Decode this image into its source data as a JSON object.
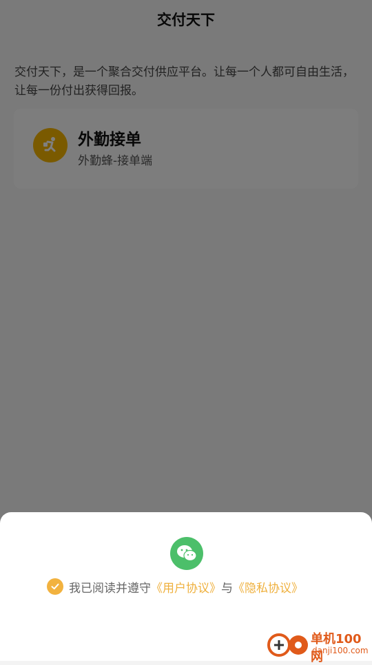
{
  "header": {
    "title": "交付天下"
  },
  "intro": {
    "text": "交付天下，是一个聚合交付供应平台。让每一个人都可自由生活，让每一份付出获得回报。"
  },
  "app_card": {
    "title": "外勤接单",
    "subtitle": "外勤蜂-接单端",
    "icon": "runner-icon",
    "icon_color": "#f4b400"
  },
  "login_sheet": {
    "wechat_icon": "wechat-icon",
    "wechat_color": "#4cbf6a",
    "agreement_prefix": "我已阅读并遵守",
    "user_agreement": "《用户协议》",
    "conjunction": "与",
    "privacy_agreement": "《隐私协议》",
    "accent": "#efb03d"
  },
  "watermark": {
    "cn": "单机100网",
    "en": "danji100.com"
  }
}
